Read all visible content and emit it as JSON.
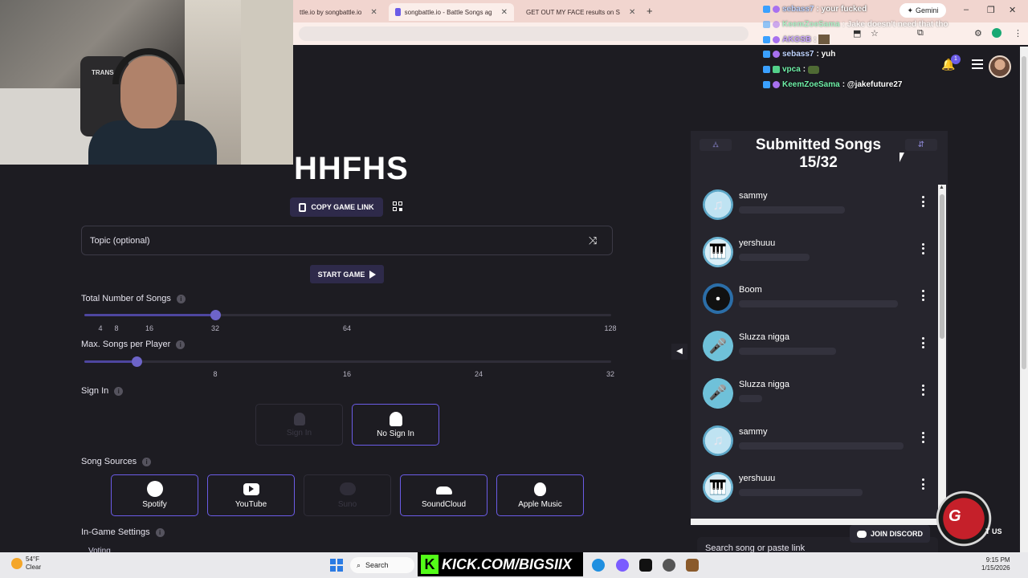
{
  "browser": {
    "tabs": [
      {
        "title": "ttle.io by songbattle.io",
        "color": "#c8b8d8"
      },
      {
        "title": "songbattle.io - Battle Songs ag",
        "color": "#6b5ce7"
      },
      {
        "title": "GET OUT MY FACE results on S",
        "color": "#e25a2f"
      }
    ],
    "new_tab": "+",
    "gemini_label": "Gemini",
    "window_controls": [
      "–",
      "❐",
      "✕"
    ],
    "toolbar_icons": [
      "⬒",
      "☆",
      "⧉",
      "⚙",
      "⋮"
    ]
  },
  "chat": [
    {
      "name": "sebass7",
      "message": ": your fucked",
      "name_class": "n-blue"
    },
    {
      "name": "KeemZoeSama",
      "message": ": Jake doesn't need that tho",
      "name_class": "n-green"
    },
    {
      "name": "AKGSB",
      "message": ":",
      "name_class": "n-purple"
    },
    {
      "name": "sebass7",
      "message": ": yuh",
      "name_class": "n-blue"
    },
    {
      "name": "vpca",
      "message": ":",
      "name_class": "n-green"
    },
    {
      "name": "KeemZoeSama",
      "message": ": @jakefuture27",
      "name_class": "n-green"
    }
  ],
  "header": {
    "notification_count": "1",
    "webcam_shirt_text": "TRANS"
  },
  "game": {
    "title": "HHFHS",
    "copy_link_label": "COPY GAME LINK",
    "topic_placeholder": "Topic (optional)",
    "start_label": "START GAME",
    "info_glyph": "i",
    "total_songs_label": "Total Number of Songs",
    "total_songs_ticks": [
      "4",
      "8",
      "16",
      "32",
      "64",
      "128"
    ],
    "total_songs_value": 32,
    "max_per_player_label": "Max. Songs per Player",
    "max_per_player_ticks": [
      "8",
      "16",
      "24",
      "32"
    ],
    "max_per_player_value": 2,
    "sign_in_label": "Sign In",
    "sign_in_options": [
      {
        "label": "Sign In",
        "enabled": false
      },
      {
        "label": "No Sign In",
        "enabled": true
      }
    ],
    "song_sources_label": "Song Sources",
    "song_sources": [
      {
        "label": "Spotify",
        "icon": "spotify-icon",
        "enabled": true
      },
      {
        "label": "YouTube",
        "icon": "youtube-icon",
        "enabled": true
      },
      {
        "label": "Suno",
        "icon": "suno-icon",
        "enabled": false
      },
      {
        "label": "SoundCloud",
        "icon": "soundcloud-icon",
        "enabled": true
      },
      {
        "label": "Apple Music",
        "icon": "apple-icon",
        "enabled": true
      }
    ],
    "in_game_settings_label": "In-Game Settings",
    "voting_label": "Voting"
  },
  "submitted": {
    "title": "Submitted Songs",
    "count": "15/32",
    "songs": [
      {
        "name": "sammy",
        "icon": "band-icon",
        "bar_fraction": 0.6
      },
      {
        "name": "yershuuu",
        "icon": "piano-icon",
        "bar_fraction": 0.4
      },
      {
        "name": "Boom",
        "icon": "vinyl-icon",
        "bar_fraction": 0.9
      },
      {
        "name": "Sluzza nigga",
        "icon": "microphone-icon",
        "bar_fraction": 0.55
      },
      {
        "name": "Sluzza nigga",
        "icon": "microphone-icon",
        "bar_fraction": 0.13
      },
      {
        "name": "sammy",
        "icon": "band-icon",
        "bar_fraction": 0.93
      },
      {
        "name": "yershuuu",
        "icon": "piano-icon",
        "bar_fraction": 0.7
      }
    ],
    "search_placeholder": "Search song or paste link",
    "discord_label": "JOIN DISCORD",
    "us_label": "T US"
  },
  "taskbar": {
    "temperature": "54°F",
    "weather": "Clear",
    "search_label": "Search",
    "kick_text": "KICK.COM/BIGSIIX",
    "time": "9:15 PM",
    "date": "1/15/2026"
  },
  "colors": {
    "accent": "#6b5ce7",
    "background": "#1d1c22",
    "panel": "#26252d"
  }
}
